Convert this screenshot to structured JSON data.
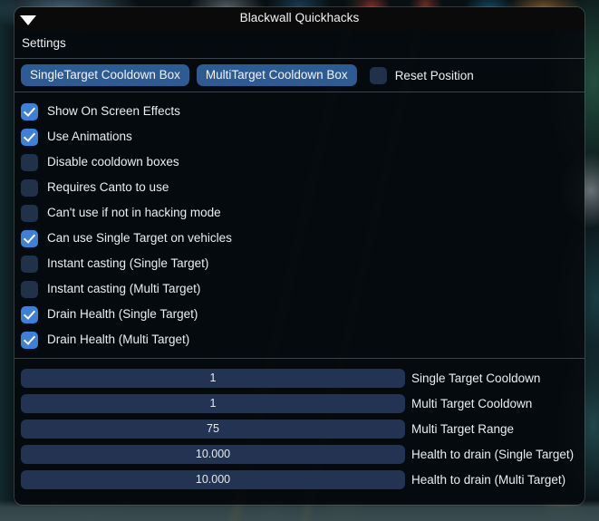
{
  "window": {
    "title": "Blackwall Quickhacks",
    "collapse_icon": "triangle-down-icon"
  },
  "settings_header": {
    "label": "Settings"
  },
  "toolbar": {
    "buttons": [
      {
        "label": "SingleTarget Cooldown Box"
      },
      {
        "label": "MultiTarget Cooldown Box"
      }
    ],
    "reset_position": {
      "label": "Reset Position",
      "checked": false
    }
  },
  "options": [
    {
      "label": "Show On Screen Effects",
      "checked": true
    },
    {
      "label": "Use Animations",
      "checked": true
    },
    {
      "label": "Disable cooldown boxes",
      "checked": false
    },
    {
      "label": "Requires Canto to use",
      "checked": false
    },
    {
      "label": "Can't use if not in hacking mode",
      "checked": false
    },
    {
      "label": "Can use Single Target on vehicles",
      "checked": true
    },
    {
      "label": "Instant casting (Single Target)",
      "checked": false
    },
    {
      "label": "Instant casting (Multi Target)",
      "checked": false
    },
    {
      "label": "Drain Health (Single Target)",
      "checked": true
    },
    {
      "label": "Drain Health (Multi Target)",
      "checked": true
    }
  ],
  "sliders": [
    {
      "value": "1",
      "label": "Single Target Cooldown"
    },
    {
      "value": "1",
      "label": "Multi Target Cooldown"
    },
    {
      "value": "75",
      "label": "Multi Target Range"
    },
    {
      "value": "10.000",
      "label": "Health to drain (Single Target)"
    },
    {
      "value": "10.000",
      "label": "Health to drain (Multi Target)"
    }
  ],
  "colors": {
    "panel_background": "#060a0d",
    "titlebar": "#0a0a0b",
    "tab_button": "#2d5b94",
    "checkbox_checked": "#3e80d8",
    "checkbox_unchecked": "#22314a",
    "slider_track": "#223353",
    "text": "#eceff1",
    "separator": "#8c96a0"
  }
}
